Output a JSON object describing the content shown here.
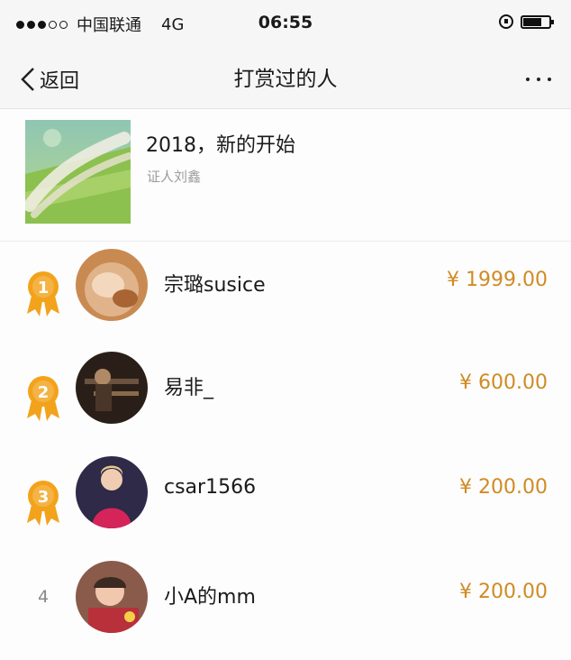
{
  "status_bar": {
    "carrier": "中国联通",
    "network": "4G",
    "time": "06:55"
  },
  "nav": {
    "back_label": "返回",
    "title": "打赏过的人"
  },
  "article": {
    "title": "2018，新的开始",
    "author": "证人刘鑫"
  },
  "rewarders": [
    {
      "rank": "1",
      "name": "宗璐susice",
      "amount": "¥ 1999.00"
    },
    {
      "rank": "2",
      "name": "易非_",
      "amount": "¥ 600.00"
    },
    {
      "rank": "3",
      "name": "csar1566",
      "amount": "¥ 200.00"
    },
    {
      "rank": "4",
      "name": "小A的mm",
      "amount": "¥ 200.00"
    }
  ],
  "colors": {
    "amount": "#d08b24",
    "medal": "#f2a31b"
  }
}
